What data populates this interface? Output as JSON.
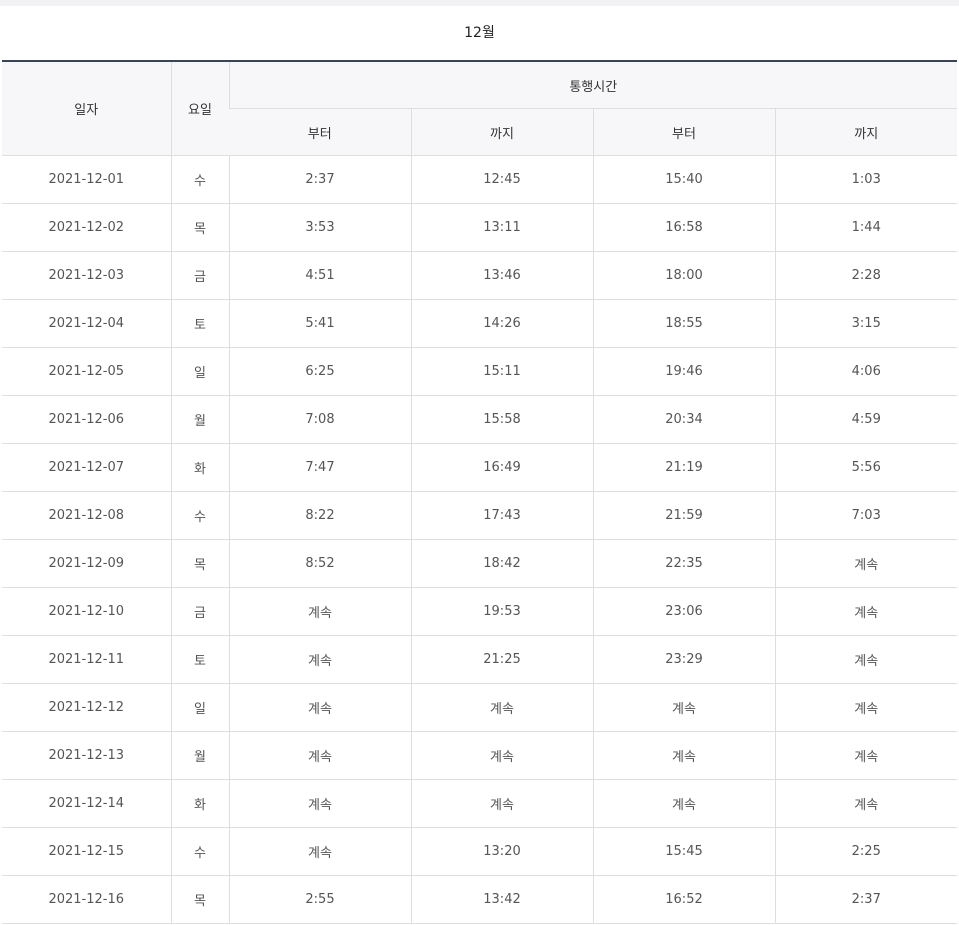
{
  "month_title": "12월",
  "headers": {
    "date": "일자",
    "weekday": "요일",
    "group": "통행시간",
    "from1": "부터",
    "to1": "까지",
    "from2": "부터",
    "to2": "까지"
  },
  "rows": [
    {
      "date": "2021-12-01",
      "day": "수",
      "from1": "2:37",
      "to1": "12:45",
      "from2": "15:40",
      "to2": "1:03"
    },
    {
      "date": "2021-12-02",
      "day": "목",
      "from1": "3:53",
      "to1": "13:11",
      "from2": "16:58",
      "to2": "1:44"
    },
    {
      "date": "2021-12-03",
      "day": "금",
      "from1": "4:51",
      "to1": "13:46",
      "from2": "18:00",
      "to2": "2:28"
    },
    {
      "date": "2021-12-04",
      "day": "토",
      "from1": "5:41",
      "to1": "14:26",
      "from2": "18:55",
      "to2": "3:15"
    },
    {
      "date": "2021-12-05",
      "day": "일",
      "from1": "6:25",
      "to1": "15:11",
      "from2": "19:46",
      "to2": "4:06"
    },
    {
      "date": "2021-12-06",
      "day": "월",
      "from1": "7:08",
      "to1": "15:58",
      "from2": "20:34",
      "to2": "4:59"
    },
    {
      "date": "2021-12-07",
      "day": "화",
      "from1": "7:47",
      "to1": "16:49",
      "from2": "21:19",
      "to2": "5:56"
    },
    {
      "date": "2021-12-08",
      "day": "수",
      "from1": "8:22",
      "to1": "17:43",
      "from2": "21:59",
      "to2": "7:03"
    },
    {
      "date": "2021-12-09",
      "day": "목",
      "from1": "8:52",
      "to1": "18:42",
      "from2": "22:35",
      "to2": "계속"
    },
    {
      "date": "2021-12-10",
      "day": "금",
      "from1": "계속",
      "to1": "19:53",
      "from2": "23:06",
      "to2": "계속"
    },
    {
      "date": "2021-12-11",
      "day": "토",
      "from1": "계속",
      "to1": "21:25",
      "from2": "23:29",
      "to2": "계속"
    },
    {
      "date": "2021-12-12",
      "day": "일",
      "from1": "계속",
      "to1": "계속",
      "from2": "계속",
      "to2": "계속"
    },
    {
      "date": "2021-12-13",
      "day": "월",
      "from1": "계속",
      "to1": "계속",
      "from2": "계속",
      "to2": "계속"
    },
    {
      "date": "2021-12-14",
      "day": "화",
      "from1": "계속",
      "to1": "계속",
      "from2": "계속",
      "to2": "계속"
    },
    {
      "date": "2021-12-15",
      "day": "수",
      "from1": "계속",
      "to1": "13:20",
      "from2": "15:45",
      "to2": "2:25"
    },
    {
      "date": "2021-12-16",
      "day": "목",
      "from1": "2:55",
      "to1": "13:42",
      "from2": "16:52",
      "to2": "2:37"
    }
  ]
}
